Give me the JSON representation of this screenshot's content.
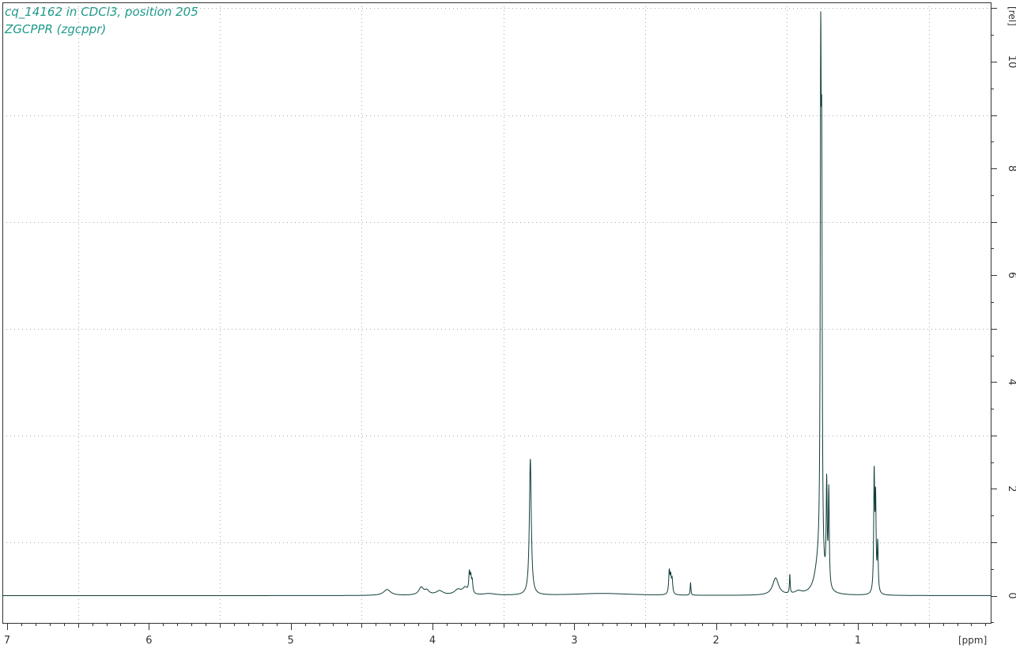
{
  "header": {
    "title_line1": "cq_14162 in CDCl3, position 205",
    "title_line2": "ZGCPPR (zgcppr)"
  },
  "colors": {
    "spectrum": "#0f3d3a",
    "title": "#1f9a8a",
    "grid": "#a8a8a8",
    "axis": "#333333"
  },
  "chart_data": {
    "type": "line",
    "title": "cq_14162 in CDCl3, position 205",
    "subtitle": "ZGCPPR (zgcppr)",
    "xlabel": "[ppm]",
    "ylabel": "[rel]",
    "x_reversed": true,
    "xlim": [
      7.0,
      0.0
    ],
    "ylim": [
      -0.5,
      11.1
    ],
    "x_ticks": [
      7,
      6,
      5,
      4,
      3,
      2,
      1
    ],
    "y_ticks": [
      0,
      2,
      4,
      6,
      8,
      10
    ],
    "grid": true,
    "baseline": 0,
    "peaks": [
      {
        "ppm": 4.32,
        "height": 0.11,
        "width": 0.03
      },
      {
        "ppm": 4.08,
        "height": 0.14,
        "width": 0.02
      },
      {
        "ppm": 4.04,
        "height": 0.08,
        "width": 0.02
      },
      {
        "ppm": 3.95,
        "height": 0.08,
        "width": 0.03
      },
      {
        "ppm": 3.82,
        "height": 0.1,
        "width": 0.03
      },
      {
        "ppm": 3.77,
        "height": 0.12,
        "width": 0.02
      },
      {
        "ppm": 3.74,
        "height": 0.36,
        "width": 0.005
      },
      {
        "ppm": 3.73,
        "height": 0.28,
        "width": 0.005
      },
      {
        "ppm": 3.72,
        "height": 0.22,
        "width": 0.005
      },
      {
        "ppm": 3.6,
        "height": 0.03,
        "width": 0.05
      },
      {
        "ppm": 3.31,
        "height": 2.55,
        "width": 0.008
      },
      {
        "ppm": 2.8,
        "height": 0.04,
        "width": 0.25
      },
      {
        "ppm": 2.33,
        "height": 0.42,
        "width": 0.005
      },
      {
        "ppm": 2.32,
        "height": 0.3,
        "width": 0.005
      },
      {
        "ppm": 2.31,
        "height": 0.26,
        "width": 0.005
      },
      {
        "ppm": 2.18,
        "height": 0.24,
        "width": 0.003
      },
      {
        "ppm": 1.58,
        "height": 0.32,
        "width": 0.025
      },
      {
        "ppm": 1.48,
        "height": 0.36,
        "width": 0.003
      },
      {
        "ppm": 1.42,
        "height": 0.06,
        "width": 0.03
      },
      {
        "ppm": 1.28,
        "height": 0.5,
        "width": 0.03
      },
      {
        "ppm": 1.262,
        "height": 8.9,
        "width": 0.004
      },
      {
        "ppm": 1.255,
        "height": 6.8,
        "width": 0.004
      },
      {
        "ppm": 1.22,
        "height": 1.9,
        "width": 0.004
      },
      {
        "ppm": 1.205,
        "height": 1.8,
        "width": 0.004
      },
      {
        "ppm": 0.885,
        "height": 2.2,
        "width": 0.004
      },
      {
        "ppm": 0.875,
        "height": 1.7,
        "width": 0.004
      },
      {
        "ppm": 0.86,
        "height": 0.9,
        "width": 0.004
      },
      {
        "ppm": 0.05,
        "height": 0.06,
        "width": 0.002
      }
    ]
  }
}
